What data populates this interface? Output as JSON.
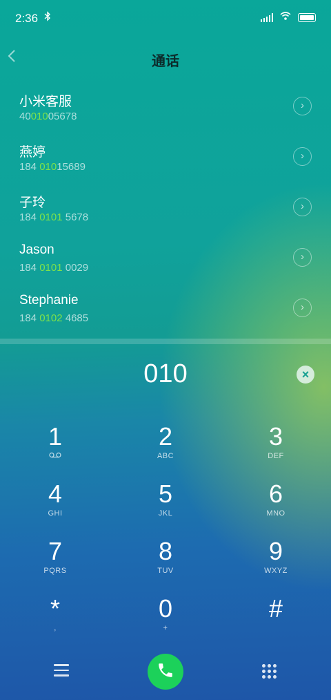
{
  "status_bar": {
    "time": "2:36",
    "bluetooth_icon": "bluetooth-icon",
    "signal_icon": "signal-icon",
    "wifi_icon": "wifi-icon",
    "battery_icon": "battery-icon"
  },
  "header": {
    "title": "通话",
    "back_icon": "chevron-left-icon"
  },
  "results": [
    {
      "name": "小米客服",
      "num_pre": "40",
      "num_hl": "010",
      "num_post": "05678"
    },
    {
      "name": "燕婷",
      "num_pre": "184 ",
      "num_hl": "010",
      "num_post": "15689"
    },
    {
      "name": "子玲",
      "num_pre": "184 ",
      "num_hl": "0101",
      "num_post": " 5678"
    },
    {
      "name": "Jason",
      "num_pre": "184 ",
      "num_hl": "0101",
      "num_post": " 0029"
    },
    {
      "name": "Stephanie",
      "num_pre": "184 ",
      "num_hl": "0102",
      "num_post": " 4685"
    }
  ],
  "dialer": {
    "entered": "010",
    "clear_icon": "clear-icon"
  },
  "keys": [
    {
      "d": "1",
      "l": "voicemail"
    },
    {
      "d": "2",
      "l": "ABC"
    },
    {
      "d": "3",
      "l": "DEF"
    },
    {
      "d": "4",
      "l": "GHI"
    },
    {
      "d": "5",
      "l": "JKL"
    },
    {
      "d": "6",
      "l": "MNO"
    },
    {
      "d": "7",
      "l": "PQRS"
    },
    {
      "d": "8",
      "l": "TUV"
    },
    {
      "d": "9",
      "l": "WXYZ"
    },
    {
      "d": "*",
      "l": ","
    },
    {
      "d": "0",
      "l": "+"
    },
    {
      "d": "#",
      "l": ""
    }
  ],
  "bottom": {
    "menu_icon": "menu-icon",
    "call_icon": "phone-icon",
    "dialpad_icon": "dialpad-icon"
  },
  "colors": {
    "highlight": "#7ee24a",
    "call": "#1cd15a"
  }
}
